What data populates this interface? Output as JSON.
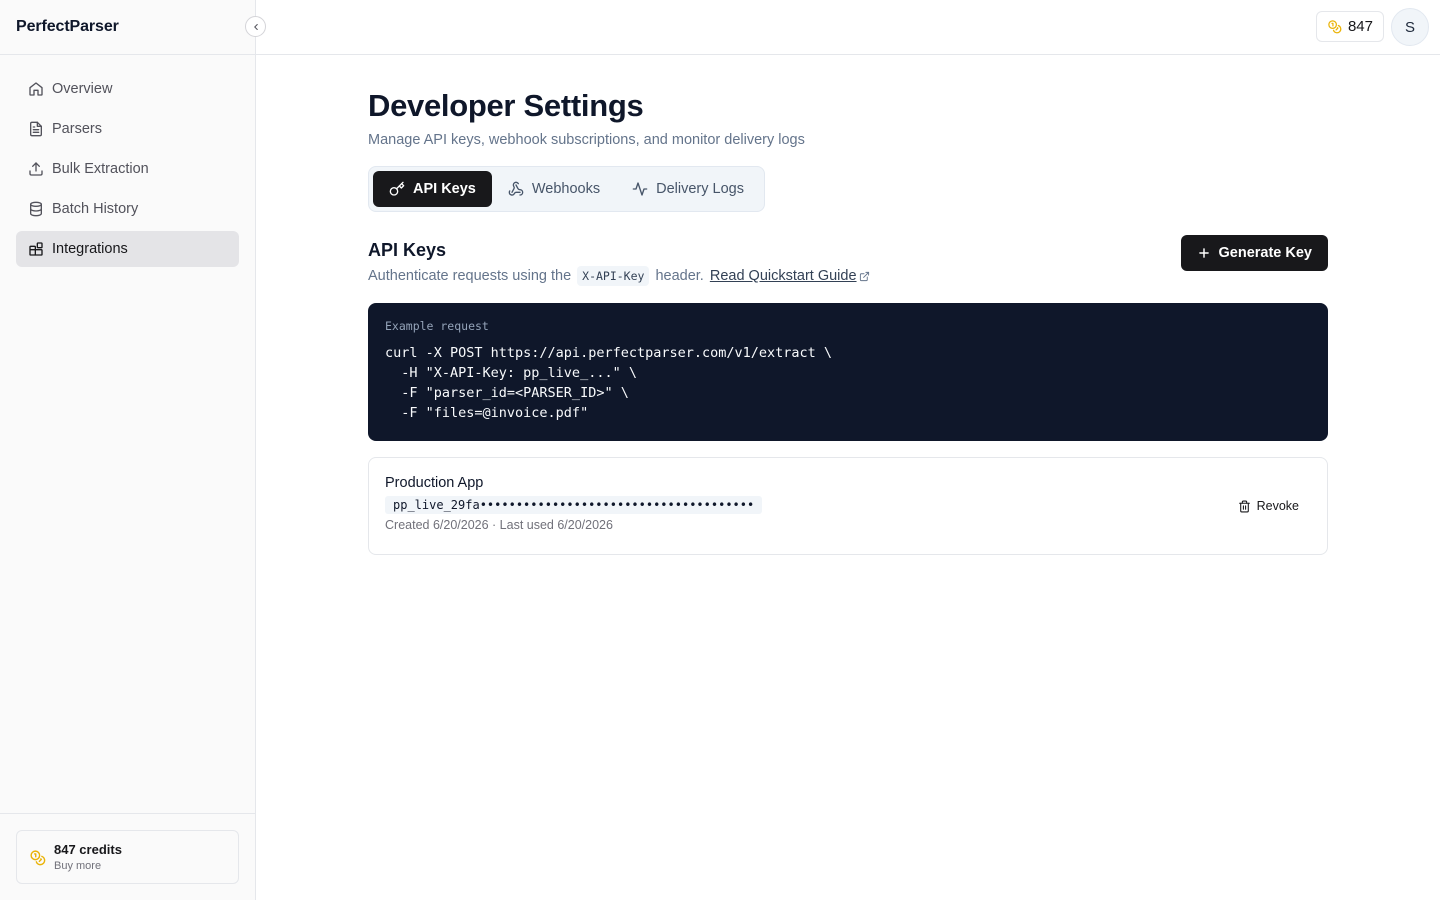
{
  "app": {
    "brand": "PerfectParser"
  },
  "sidebar": {
    "items": [
      {
        "label": "Overview",
        "icon": "home-icon",
        "active": false
      },
      {
        "label": "Parsers",
        "icon": "document-icon",
        "active": false
      },
      {
        "label": "Bulk Extraction",
        "icon": "upload-icon",
        "active": false
      },
      {
        "label": "Batch History",
        "icon": "database-icon",
        "active": false
      },
      {
        "label": "Integrations",
        "icon": "blocks-icon",
        "active": true
      }
    ],
    "footer": {
      "credits_label": "847 credits",
      "buy_more": "Buy more",
      "icon": "coins-icon"
    }
  },
  "topbar": {
    "credits": "847",
    "credits_icon": "coins-icon",
    "avatar_initial": "S"
  },
  "page": {
    "title": "Developer Settings",
    "subtitle": "Manage API keys, webhook subscriptions, and monitor delivery logs"
  },
  "tabs": [
    {
      "label": "API Keys",
      "icon": "key-icon",
      "active": true
    },
    {
      "label": "Webhooks",
      "icon": "webhook-icon",
      "active": false
    },
    {
      "label": "Delivery Logs",
      "icon": "activity-icon",
      "active": false
    }
  ],
  "api_keys": {
    "title": "API Keys",
    "desc_prefix": "Authenticate requests using the",
    "header_name": "X-API-Key",
    "desc_suffix": "header.",
    "guide_link": "Read Quickstart Guide",
    "generate_button": "Generate Key",
    "example": {
      "label": "Example request",
      "lines": [
        "curl -X POST https://api.perfectparser.com/v1/extract \\",
        "  -H \"X-API-Key: pp_live_...\" \\",
        "  -F \"parser_id=<PARSER_ID>\" \\",
        "  -F \"files=@invoice.pdf\""
      ]
    },
    "keys": [
      {
        "name": "Production App",
        "masked_key": "pp_live_29fa••••••••••••••••••••••••••••••••••••••",
        "meta": "Created 6/20/2026 · Last used 6/20/2026",
        "revoke_label": "Revoke"
      }
    ]
  },
  "colors": {
    "primary": "#18181b",
    "accent_coin": "#eab308",
    "code_bg": "#0f172a",
    "muted": "#64748b"
  }
}
